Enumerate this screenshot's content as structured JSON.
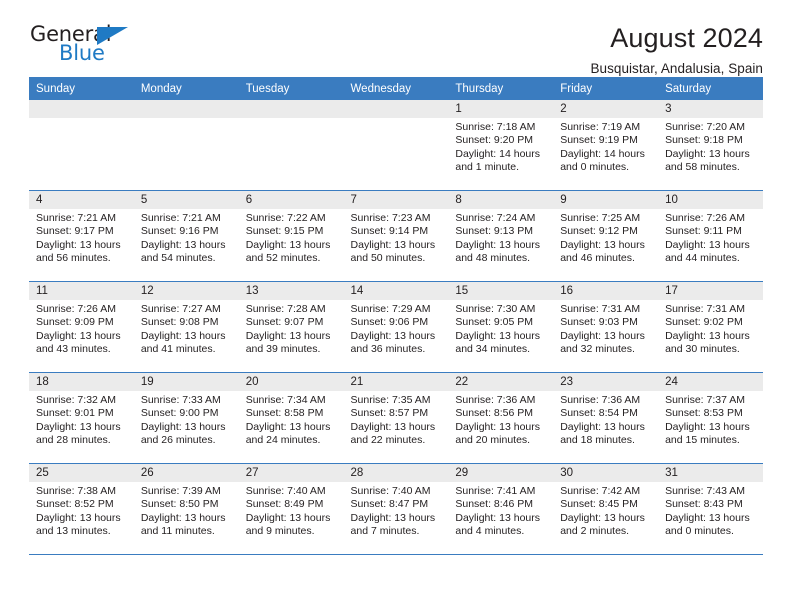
{
  "brand": {
    "name_top": "General",
    "name_bottom": "Blue",
    "accent_color": "#1f7ac4",
    "triangle_icon": "triangle-icon"
  },
  "header": {
    "title": "August 2024",
    "subtitle": "Busquistar, Andalusia, Spain"
  },
  "theme": {
    "header_band": "#3a7cc0",
    "daynum_strip": "#ebebeb",
    "text": "#231f20"
  },
  "weekdays": [
    "Sunday",
    "Monday",
    "Tuesday",
    "Wednesday",
    "Thursday",
    "Friday",
    "Saturday"
  ],
  "weeks": [
    [
      {
        "day": "",
        "sunrise": "",
        "sunset": "",
        "daylight_1": "",
        "daylight_2": ""
      },
      {
        "day": "",
        "sunrise": "",
        "sunset": "",
        "daylight_1": "",
        "daylight_2": ""
      },
      {
        "day": "",
        "sunrise": "",
        "sunset": "",
        "daylight_1": "",
        "daylight_2": ""
      },
      {
        "day": "",
        "sunrise": "",
        "sunset": "",
        "daylight_1": "",
        "daylight_2": ""
      },
      {
        "day": "1",
        "sunrise": "Sunrise: 7:18 AM",
        "sunset": "Sunset: 9:20 PM",
        "daylight_1": "Daylight: 14 hours",
        "daylight_2": "and 1 minute."
      },
      {
        "day": "2",
        "sunrise": "Sunrise: 7:19 AM",
        "sunset": "Sunset: 9:19 PM",
        "daylight_1": "Daylight: 14 hours",
        "daylight_2": "and 0 minutes."
      },
      {
        "day": "3",
        "sunrise": "Sunrise: 7:20 AM",
        "sunset": "Sunset: 9:18 PM",
        "daylight_1": "Daylight: 13 hours",
        "daylight_2": "and 58 minutes."
      }
    ],
    [
      {
        "day": "4",
        "sunrise": "Sunrise: 7:21 AM",
        "sunset": "Sunset: 9:17 PM",
        "daylight_1": "Daylight: 13 hours",
        "daylight_2": "and 56 minutes."
      },
      {
        "day": "5",
        "sunrise": "Sunrise: 7:21 AM",
        "sunset": "Sunset: 9:16 PM",
        "daylight_1": "Daylight: 13 hours",
        "daylight_2": "and 54 minutes."
      },
      {
        "day": "6",
        "sunrise": "Sunrise: 7:22 AM",
        "sunset": "Sunset: 9:15 PM",
        "daylight_1": "Daylight: 13 hours",
        "daylight_2": "and 52 minutes."
      },
      {
        "day": "7",
        "sunrise": "Sunrise: 7:23 AM",
        "sunset": "Sunset: 9:14 PM",
        "daylight_1": "Daylight: 13 hours",
        "daylight_2": "and 50 minutes."
      },
      {
        "day": "8",
        "sunrise": "Sunrise: 7:24 AM",
        "sunset": "Sunset: 9:13 PM",
        "daylight_1": "Daylight: 13 hours",
        "daylight_2": "and 48 minutes."
      },
      {
        "day": "9",
        "sunrise": "Sunrise: 7:25 AM",
        "sunset": "Sunset: 9:12 PM",
        "daylight_1": "Daylight: 13 hours",
        "daylight_2": "and 46 minutes."
      },
      {
        "day": "10",
        "sunrise": "Sunrise: 7:26 AM",
        "sunset": "Sunset: 9:11 PM",
        "daylight_1": "Daylight: 13 hours",
        "daylight_2": "and 44 minutes."
      }
    ],
    [
      {
        "day": "11",
        "sunrise": "Sunrise: 7:26 AM",
        "sunset": "Sunset: 9:09 PM",
        "daylight_1": "Daylight: 13 hours",
        "daylight_2": "and 43 minutes."
      },
      {
        "day": "12",
        "sunrise": "Sunrise: 7:27 AM",
        "sunset": "Sunset: 9:08 PM",
        "daylight_1": "Daylight: 13 hours",
        "daylight_2": "and 41 minutes."
      },
      {
        "day": "13",
        "sunrise": "Sunrise: 7:28 AM",
        "sunset": "Sunset: 9:07 PM",
        "daylight_1": "Daylight: 13 hours",
        "daylight_2": "and 39 minutes."
      },
      {
        "day": "14",
        "sunrise": "Sunrise: 7:29 AM",
        "sunset": "Sunset: 9:06 PM",
        "daylight_1": "Daylight: 13 hours",
        "daylight_2": "and 36 minutes."
      },
      {
        "day": "15",
        "sunrise": "Sunrise: 7:30 AM",
        "sunset": "Sunset: 9:05 PM",
        "daylight_1": "Daylight: 13 hours",
        "daylight_2": "and 34 minutes."
      },
      {
        "day": "16",
        "sunrise": "Sunrise: 7:31 AM",
        "sunset": "Sunset: 9:03 PM",
        "daylight_1": "Daylight: 13 hours",
        "daylight_2": "and 32 minutes."
      },
      {
        "day": "17",
        "sunrise": "Sunrise: 7:31 AM",
        "sunset": "Sunset: 9:02 PM",
        "daylight_1": "Daylight: 13 hours",
        "daylight_2": "and 30 minutes."
      }
    ],
    [
      {
        "day": "18",
        "sunrise": "Sunrise: 7:32 AM",
        "sunset": "Sunset: 9:01 PM",
        "daylight_1": "Daylight: 13 hours",
        "daylight_2": "and 28 minutes."
      },
      {
        "day": "19",
        "sunrise": "Sunrise: 7:33 AM",
        "sunset": "Sunset: 9:00 PM",
        "daylight_1": "Daylight: 13 hours",
        "daylight_2": "and 26 minutes."
      },
      {
        "day": "20",
        "sunrise": "Sunrise: 7:34 AM",
        "sunset": "Sunset: 8:58 PM",
        "daylight_1": "Daylight: 13 hours",
        "daylight_2": "and 24 minutes."
      },
      {
        "day": "21",
        "sunrise": "Sunrise: 7:35 AM",
        "sunset": "Sunset: 8:57 PM",
        "daylight_1": "Daylight: 13 hours",
        "daylight_2": "and 22 minutes."
      },
      {
        "day": "22",
        "sunrise": "Sunrise: 7:36 AM",
        "sunset": "Sunset: 8:56 PM",
        "daylight_1": "Daylight: 13 hours",
        "daylight_2": "and 20 minutes."
      },
      {
        "day": "23",
        "sunrise": "Sunrise: 7:36 AM",
        "sunset": "Sunset: 8:54 PM",
        "daylight_1": "Daylight: 13 hours",
        "daylight_2": "and 18 minutes."
      },
      {
        "day": "24",
        "sunrise": "Sunrise: 7:37 AM",
        "sunset": "Sunset: 8:53 PM",
        "daylight_1": "Daylight: 13 hours",
        "daylight_2": "and 15 minutes."
      }
    ],
    [
      {
        "day": "25",
        "sunrise": "Sunrise: 7:38 AM",
        "sunset": "Sunset: 8:52 PM",
        "daylight_1": "Daylight: 13 hours",
        "daylight_2": "and 13 minutes."
      },
      {
        "day": "26",
        "sunrise": "Sunrise: 7:39 AM",
        "sunset": "Sunset: 8:50 PM",
        "daylight_1": "Daylight: 13 hours",
        "daylight_2": "and 11 minutes."
      },
      {
        "day": "27",
        "sunrise": "Sunrise: 7:40 AM",
        "sunset": "Sunset: 8:49 PM",
        "daylight_1": "Daylight: 13 hours",
        "daylight_2": "and 9 minutes."
      },
      {
        "day": "28",
        "sunrise": "Sunrise: 7:40 AM",
        "sunset": "Sunset: 8:47 PM",
        "daylight_1": "Daylight: 13 hours",
        "daylight_2": "and 7 minutes."
      },
      {
        "day": "29",
        "sunrise": "Sunrise: 7:41 AM",
        "sunset": "Sunset: 8:46 PM",
        "daylight_1": "Daylight: 13 hours",
        "daylight_2": "and 4 minutes."
      },
      {
        "day": "30",
        "sunrise": "Sunrise: 7:42 AM",
        "sunset": "Sunset: 8:45 PM",
        "daylight_1": "Daylight: 13 hours",
        "daylight_2": "and 2 minutes."
      },
      {
        "day": "31",
        "sunrise": "Sunrise: 7:43 AM",
        "sunset": "Sunset: 8:43 PM",
        "daylight_1": "Daylight: 13 hours",
        "daylight_2": "and 0 minutes."
      }
    ]
  ]
}
